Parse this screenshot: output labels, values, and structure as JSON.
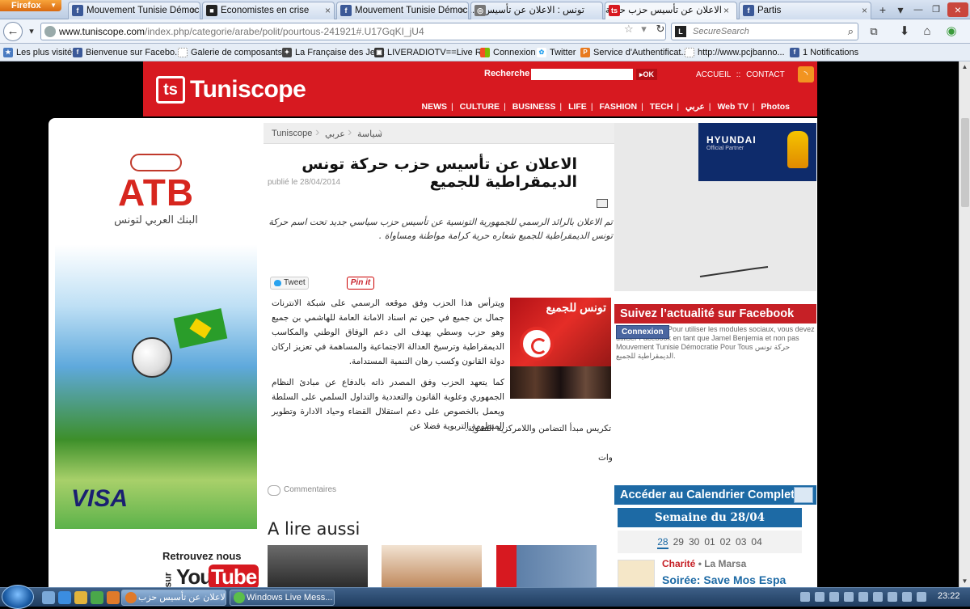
{
  "browser": {
    "menu_label": "Firefox",
    "tabs": [
      {
        "title": "Mouvement Tunisie Démoc...",
        "icon": "facebook-icon",
        "active": false
      },
      {
        "title": "Economistes en crise",
        "icon": "site-icon",
        "active": false
      },
      {
        "title": "Mouvement Tunisie Démoc...",
        "icon": "facebook-icon",
        "active": false
      },
      {
        "title": "تونس : الاعلان عن تأسيس ح...",
        "icon": "site-icon",
        "active": false
      },
      {
        "title": "الاعلان عن تأسيس حزب حركة...",
        "icon": "tuniscope-icon",
        "active": true
      },
      {
        "title": "Partis",
        "icon": "site-icon",
        "active": false
      }
    ],
    "url_domain": "www.tuniscope.com",
    "url_path": "/index.php/categorie/arabe/polit/pourtous-241921#.U17GqKI_jU4",
    "search_placeholder": "SecureSearch",
    "bookmarks": [
      "Les plus visités",
      "Bienvenue sur Facebo...",
      "Galerie de composants...",
      "La Française des Jeux",
      "LIVERADIOTV==Live R...",
      "Connexion",
      "Twitter",
      "Service d'Authentificat...",
      "http://www.pcjbanno...",
      "1 Notifications"
    ]
  },
  "site": {
    "logo_badge": "ts",
    "logo_name": "Tuniscope",
    "search_label": "Recherche :",
    "search_button": "OK",
    "top_links": [
      "ACCUEIL",
      "::",
      "CONTACT"
    ],
    "nav": [
      "NEWS",
      "CULTURE",
      "BUSINESS",
      "LIFE",
      "FASHION",
      "TECH",
      "عربي",
      "Web TV",
      "Photos"
    ]
  },
  "breadcrumb": [
    "Tuniscope",
    "عربي",
    "سياسة"
  ],
  "article": {
    "title": "الاعلان عن تأسيس حزب حركة تونس الديمقراطية للجميع",
    "date": "publié le 28/04/2014",
    "lede": "تم الاعلان بالرائد الرسمي للجمهورية التونسية عن تأسيس حزب سياسي جديد تحت اسم حركة تونس الديمقراطية للجميع شعاره حرية كرامة مواطنة ومساواة .",
    "share_tweet": "Tweet",
    "share_pin": "Pin it",
    "photo_banner": "تونس للجميع",
    "para1": "ويترأس هذا الحزب وفق موقعه الرسمي على شبكة الانترنات جمال بن جميع في حين تم اسناد الامانة العامة للهاشمي بن جميع وهو حزب وسطي يهدف الى دعم الوفاق الوطني والمكاسب الديمقراطية وترسيخ العدالة الاجتماعية والمساهمة في تعزيز اركان دولة القانون وكسب رهان التنمية المستدامة.",
    "para2": "كما يتعهد الحزب وفق المصدر ذاته بالدفاع عن مبادئ النظام الجمهوري وعلوية القانون والتعددية والتداول السلمي على السلطة ويعمل بالخصوص على دعم استقلال القضاء وحياد الادارة وتطوير المنظومة التربوية فضلا عن",
    "para2_end": "تكريس مبدأ التضامن واللامركزية التنموية.",
    "signature": "وات",
    "comments_label": "Commentaires",
    "also_read": "A lire aussi"
  },
  "left_ad": {
    "brand": "ATB",
    "brand_arabic": "البنك العربي لتونس",
    "card": "VISA"
  },
  "youtube_promo": {
    "line1": "Retrouvez nous",
    "prefix": "sur",
    "you": "You",
    "tube": "Tube"
  },
  "right": {
    "sponsor": "HYUNDAI",
    "sponsor_sub": "Official Partner",
    "facebook_title": "Suivez l’actualité sur Facebook",
    "facebook_button": "Connexion",
    "facebook_note": "Pour utiliser les modules sociaux, vous devez utiliser Facebook en tant que Jamel Benjemia et non pas Mouvement Tunisie Démocratie Pour Tous حركة تونس الديمقراطية للجميع.",
    "calendar_title": "Accéder au Calendrier Complet",
    "week_label": "Semaine du 28/04",
    "days": [
      "28",
      "29",
      "30",
      "01",
      "02",
      "03",
      "04"
    ],
    "event_category": "Charité",
    "event_location": "• La Marsa",
    "event_title": "Soirée: Save Mos Espa"
  },
  "taskbar": {
    "tasks": [
      "الاعلان عن تأسيس حزب...",
      "Windows Live Mess..."
    ],
    "clock": "23:22"
  }
}
